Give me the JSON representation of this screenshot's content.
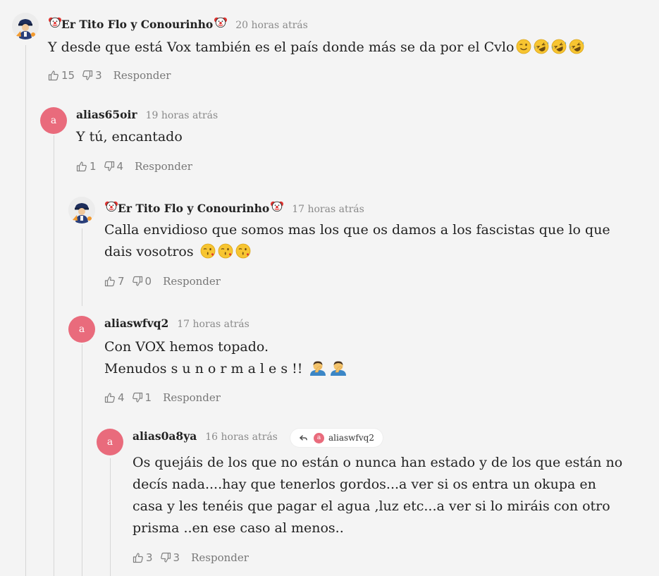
{
  "comments": [
    {
      "author": "Er Tito Flo y Conourinho",
      "time": "20 horas atrás",
      "text": "Y desde que está Vox también es el país donde más se da por el Cvlo",
      "likes": "15",
      "dislikes": "3",
      "reply": "Responder"
    },
    {
      "author": "alias65oir",
      "avatar_letter": "a",
      "time": "19 horas atrás",
      "text": "Y tú, encantado",
      "likes": "1",
      "dislikes": "4",
      "reply": "Responder"
    },
    {
      "author": "Er Tito Flo y Conourinho",
      "time": "17 horas atrás",
      "line1": "Calla envidioso que somos mas los que os damos a los fascistas que lo que",
      "line2": "dais vosotros",
      "likes": "7",
      "dislikes": "0",
      "reply": "Responder"
    },
    {
      "author": "aliaswfvq2",
      "avatar_letter": "a",
      "time": "17 horas atrás",
      "line1": "Con VOX hemos topado.",
      "line2": "Menudos s u n o r m a l e s !!",
      "likes": "4",
      "dislikes": "1",
      "reply": "Responder"
    },
    {
      "author": "alias0a8ya",
      "avatar_letter": "a",
      "time": "16 horas atrás",
      "reply_to": "aliaswfvq2",
      "reply_to_letter": "a",
      "line1": "Os quejáis de los que no están o nunca han estado y de los que están no",
      "line2": "decís nada....hay que tenerlos gordos...a ver si os entra un okupa en",
      "line3": "casa y les tenéis que pagar el agua ,luz etc...a ver si lo miráis con otro",
      "line4": "prisma ..en ese caso al menos..",
      "likes": "3",
      "dislikes": "3",
      "reply": "Responder"
    }
  ],
  "icons": {
    "like": "thumbs-up-icon",
    "dislike": "thumbs-down-icon",
    "reply_to": "reply-arrow-icon",
    "clown": "clown-face-icon",
    "wink": "winking-face-emoji",
    "laugh": "rolling-laughing-emoji",
    "kiss": "face-blowing-kiss-emoji",
    "facepalm": "person-facepalming-emoji"
  },
  "colors": {
    "avatar": "#e96b7c",
    "background": "#f4f4f4",
    "muted": "#8a8a8a"
  }
}
